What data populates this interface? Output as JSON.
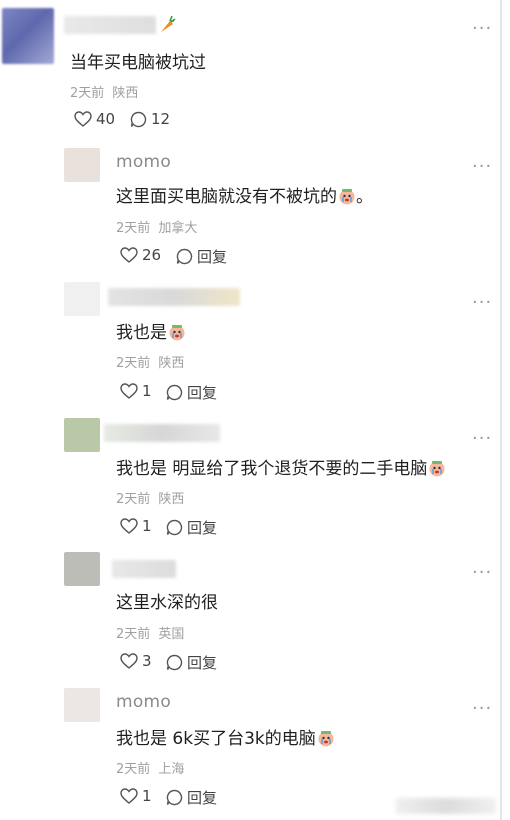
{
  "more_glyph": "···",
  "comments": [
    {
      "name": "",
      "text": "当年买电脑被坑过",
      "time": "2天前",
      "location": "陕西",
      "likes": "40",
      "replies": "12",
      "avatar_color": "#6f79b8"
    },
    {
      "name": "momo",
      "text": "这里面买电脑就没有不被坑的",
      "suffix": "。",
      "emoji": true,
      "time": "2天前",
      "location": "加拿大",
      "likes": "26",
      "reply_label": "回复",
      "avatar_color": "#e8e1dc"
    },
    {
      "name": "",
      "text": "我也是",
      "emoji": true,
      "time": "2天前",
      "location": "陕西",
      "likes": "1",
      "reply_label": "回复",
      "avatar_color": "#f0f0f0"
    },
    {
      "name": "",
      "text": "我也是 明显给了我个退货不要的二手电脑",
      "emoji": true,
      "time": "2天前",
      "location": "陕西",
      "likes": "1",
      "reply_label": "回复",
      "avatar_color": "#b9c9a8"
    },
    {
      "name": "",
      "text": "这里水深的很",
      "time": "2天前",
      "location": "英国",
      "likes": "3",
      "reply_label": "回复",
      "avatar_color": "#bdbdb8"
    },
    {
      "name": "momo",
      "text": "我也是 6k买了台3k的电脑",
      "emoji": true,
      "time": "2天前",
      "location": "上海",
      "likes": "1",
      "reply_label": "回复",
      "avatar_color": "#ece6e4"
    }
  ]
}
